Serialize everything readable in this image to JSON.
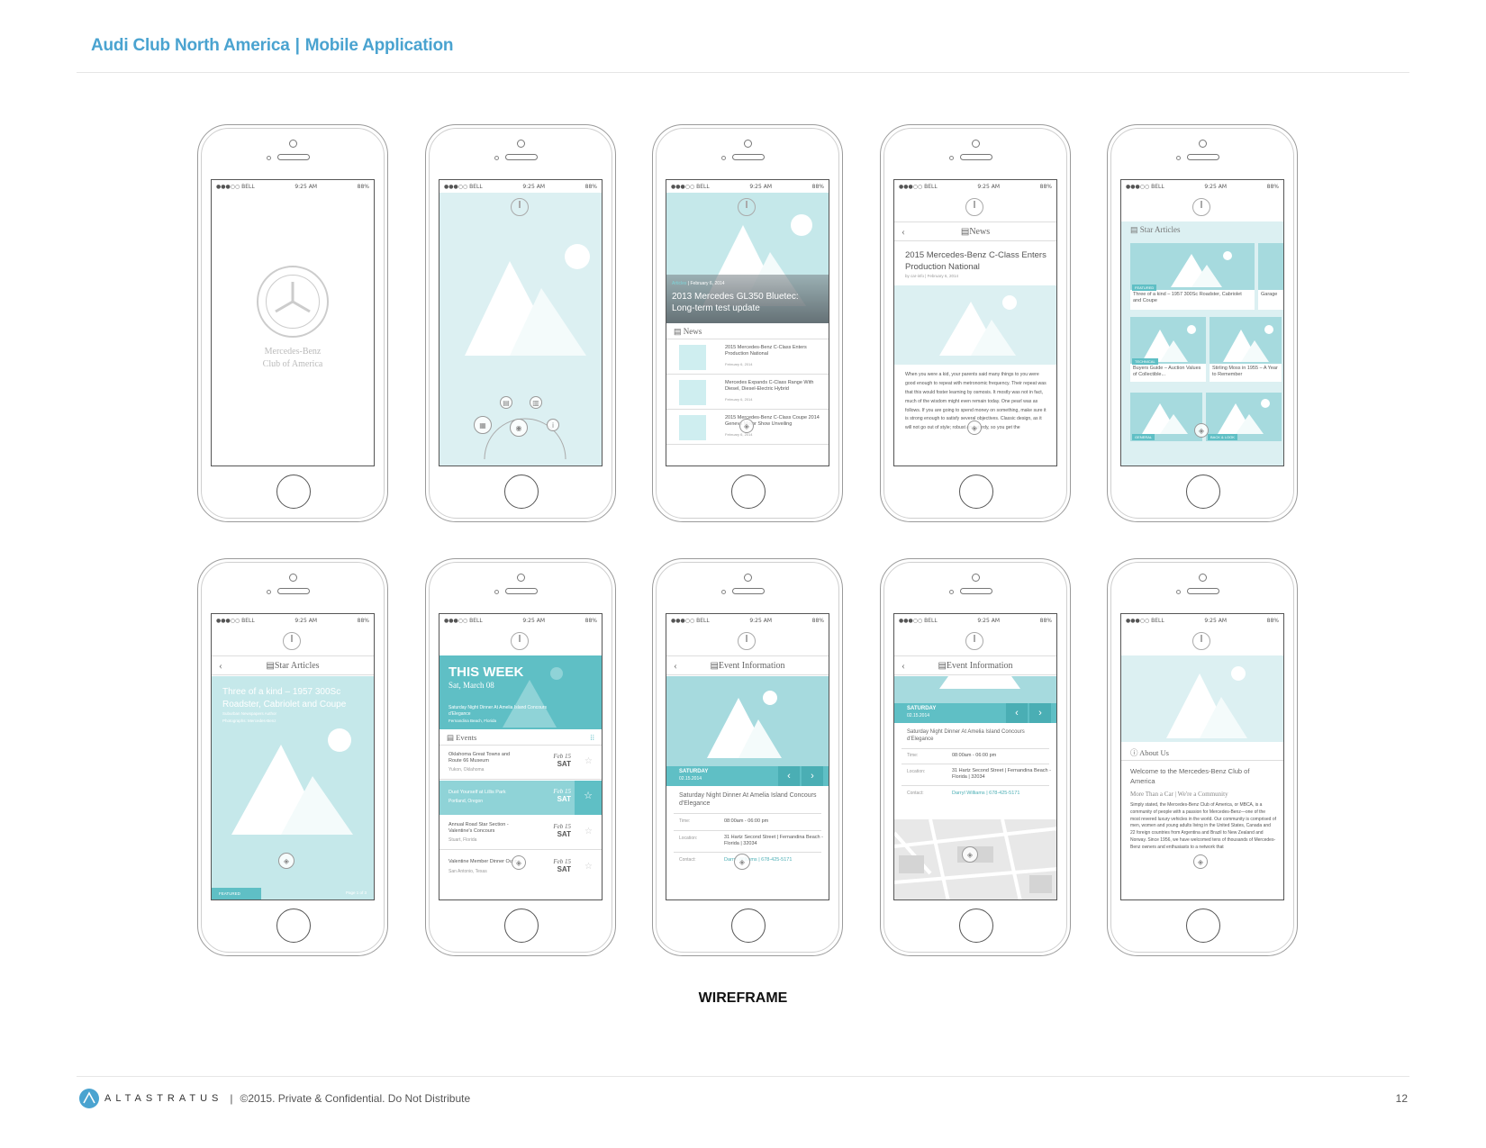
{
  "header": {
    "left": "Audi Club North America",
    "right": "Mobile Application"
  },
  "status": {
    "carrier": "●●●○○ BELL",
    "time": "9:25 AM",
    "battery": "88%"
  },
  "screens": {
    "s1": {
      "club_name_1": "Mercedes-Benz",
      "club_name_2": "Club of America"
    },
    "s3": {
      "hero_tag": "Articles",
      "hero_date": "February 6, 2014",
      "hero_title": "2013 Mercedes GL350 Bluetec: Long-term test update",
      "section": "News",
      "items": [
        "2015 Mercedes-Benz C-Class Enters Production National",
        "Mercedes Expands C-Class Range With Diesel, Diesel-Electric Hybrid",
        "2015 Mercedes-Benz C-Class Coupe 2014 Geneva Motor Show Unveiling"
      ],
      "item_date": "February 6, 2014"
    },
    "s4": {
      "nav": "News",
      "title": "2015 Mercedes-Benz C-Class Enters Production National",
      "meta": "by car-info | February 6, 2014",
      "body": "When you were a kid, your parents said many things to you were good enough to repeat with metronomic frequency. Their repeat was that this would foster learning by osmosis. It mostly was not in fact, much of the wisdom might even remain today. One pearl was as follows. If you are going to spend money on something, make sure it is strong enough to satisfy several objectives. Classic design, as it will not go out of style; robust and sturdy, so you get the"
    },
    "s5": {
      "nav": "Star Articles",
      "a1": "Three of a kind – 1957 300Sc Roadster, Cabriolet and Coupe",
      "a1_tag": "FEATURED",
      "a1b": "Garage",
      "a2": "Buyers Guide – Auction Values of Collectible...",
      "a2_tag": "TECHNICAL",
      "a3": "Stirling Moss in 1955 – A Year to Remember",
      "a4_tag": "GENERAL",
      "a5_tag": "BACK & LOOK"
    },
    "s6": {
      "nav": "Star Articles",
      "title": "Three of a kind – 1957 300Sc Roadster, Cabriolet and Coupe",
      "sub1": "Suburban Newspapers Author",
      "sub2": "Photographs: Mercedes-Benz",
      "tag": "FEATURED",
      "page": "Page 1 of 3"
    },
    "s7": {
      "banner": "THIS WEEK",
      "date": "Sat, March 08",
      "event": "Saturday Night Dinner At Amelia Island Concours d'Elegance",
      "location": "Fernandina Beach, Florida",
      "section": "Events",
      "items": [
        {
          "name": "Oklahoma Great Towns and Route 66 Museum",
          "loc": "Yukon, Oklahoma",
          "d": "Feb 15",
          "w": "SAT"
        },
        {
          "name": "Dust Yourself at Lillis Park",
          "loc": "Portland, Oregon",
          "d": "Feb 15",
          "w": "SAT"
        },
        {
          "name": "Annual Road Star Section - Valentine's Concours",
          "loc": "Stuart, Florida",
          "d": "Feb 15",
          "w": "SAT"
        },
        {
          "name": "Valentine Member Dinner Outing",
          "loc": "San Antonio, Texas",
          "d": "Feb 15",
          "w": "SAT"
        }
      ]
    },
    "s8": {
      "nav": "Event Information",
      "day": "SATURDAY",
      "date": "02.15.2014",
      "title": "Saturday Night Dinner At Amelia Island Concours d'Elegance",
      "time_label": "Time:",
      "time": "08:00am - 06:00 pm",
      "loc_label": "Location:",
      "loc": "31 Hartz Second Street | Fernandina Beach - Florida | 32034",
      "contact_label": "Contact:",
      "contact": "Darryl Williams | 678-425-5171"
    },
    "s9": {
      "nav": "Event Information",
      "day": "SATURDAY",
      "date": "02.15.2014",
      "title": "Saturday Night Dinner At Amelia Island Concours d'Elegance",
      "time_label": "Time:",
      "time": "08:00am - 06:00 pm",
      "loc_label": "Location:",
      "loc": "31 Hartz Second Street | Fernandina Beach - Florida | 32034",
      "contact_label": "Contact:",
      "contact": "Darryl Williams | 678-425-5171"
    },
    "s10": {
      "section": "About Us",
      "title": "Welcome to the Mercedes-Benz Club of America",
      "subtitle": "More Than a Car | We're a Community",
      "body": "Simply stated, the Mercedes-Benz Club of America, or MBCA, is a community of people with a passion for Mercedes-Benz—one of the most revered luxury vehicles in the world. Our community is comprised of men, women and young adults living in the United States, Canada and 22 foreign countries from Argentina and Brazil to New Zealand and Norway. Since 1956, we have welcomed tens of thousands of Mercedes-Benz owners and enthusiasts to a network that"
    }
  },
  "caption": "WIREFRAME",
  "footer": {
    "brand": "ALTASTRATUS",
    "notice": "©2015. Private & Confidential. Do Not Distribute",
    "page": "12"
  },
  "colors": {
    "accent": "#4aa3d0",
    "teal_light": "#dcf0f2",
    "teal_mid": "#a6dade",
    "teal_dark": "#5fbfc5"
  }
}
